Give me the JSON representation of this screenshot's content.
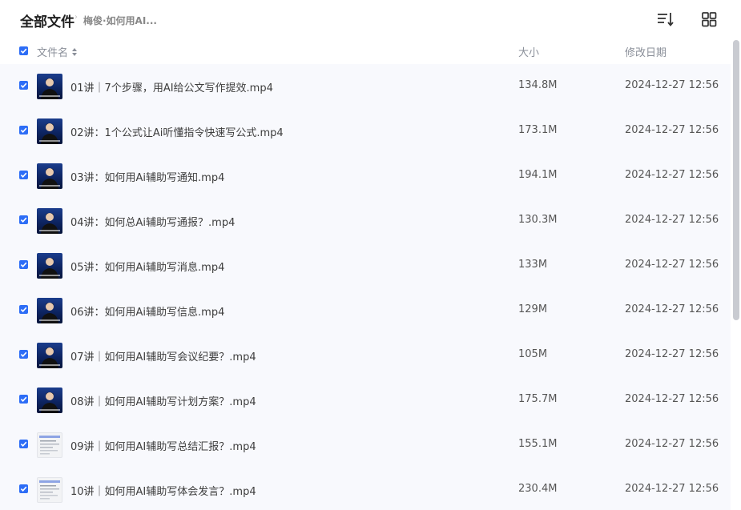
{
  "header": {
    "title": "全部文件",
    "breadcrumb_sep": "›",
    "breadcrumb": "梅俊·如何用AI...",
    "sort_icon": "sort-list-icon",
    "grid_icon": "grid-view-icon"
  },
  "columns": {
    "name": "文件名",
    "size": "大小",
    "date": "修改日期"
  },
  "colors": {
    "accent": "#2d6df6",
    "list_background": "#f8f9fd"
  },
  "files": [
    {
      "name": "01讲｜7个步骤，用AI给公文写作提效.mp4",
      "size": "134.8M",
      "date": "2024-12-27 12:56",
      "thumb": "video",
      "checked": true
    },
    {
      "name": "02讲：1个公式让Ai听懂指令快速写公式.mp4",
      "size": "173.1M",
      "date": "2024-12-27 12:56",
      "thumb": "video",
      "checked": true
    },
    {
      "name": "03讲：如何用Ai辅助写通知.mp4",
      "size": "194.1M",
      "date": "2024-12-27 12:56",
      "thumb": "video",
      "checked": true
    },
    {
      "name": "04讲：如何总Ai辅助写通报？.mp4",
      "size": "130.3M",
      "date": "2024-12-27 12:56",
      "thumb": "video",
      "checked": true
    },
    {
      "name": "05讲：如何用Ai辅助写消息.mp4",
      "size": "133M",
      "date": "2024-12-27 12:56",
      "thumb": "video",
      "checked": true
    },
    {
      "name": "06讲：如何用Ai辅助写信息.mp4",
      "size": "129M",
      "date": "2024-12-27 12:56",
      "thumb": "video",
      "checked": true
    },
    {
      "name": "07讲｜如何用AI辅助写会议纪要？.mp4",
      "size": "105M",
      "date": "2024-12-27 12:56",
      "thumb": "video",
      "checked": true
    },
    {
      "name": "08讲｜如何用AI辅助写计划方案？.mp4",
      "size": "175.7M",
      "date": "2024-12-27 12:56",
      "thumb": "video",
      "checked": true
    },
    {
      "name": "09讲｜如何用AI辅助写总结汇报？.mp4",
      "size": "155.1M",
      "date": "2024-12-27 12:56",
      "thumb": "doc",
      "checked": true
    },
    {
      "name": "10讲｜如何用AI辅助写体会发言？.mp4",
      "size": "230.4M",
      "date": "2024-12-27 12:56",
      "thumb": "doc",
      "checked": true
    }
  ]
}
